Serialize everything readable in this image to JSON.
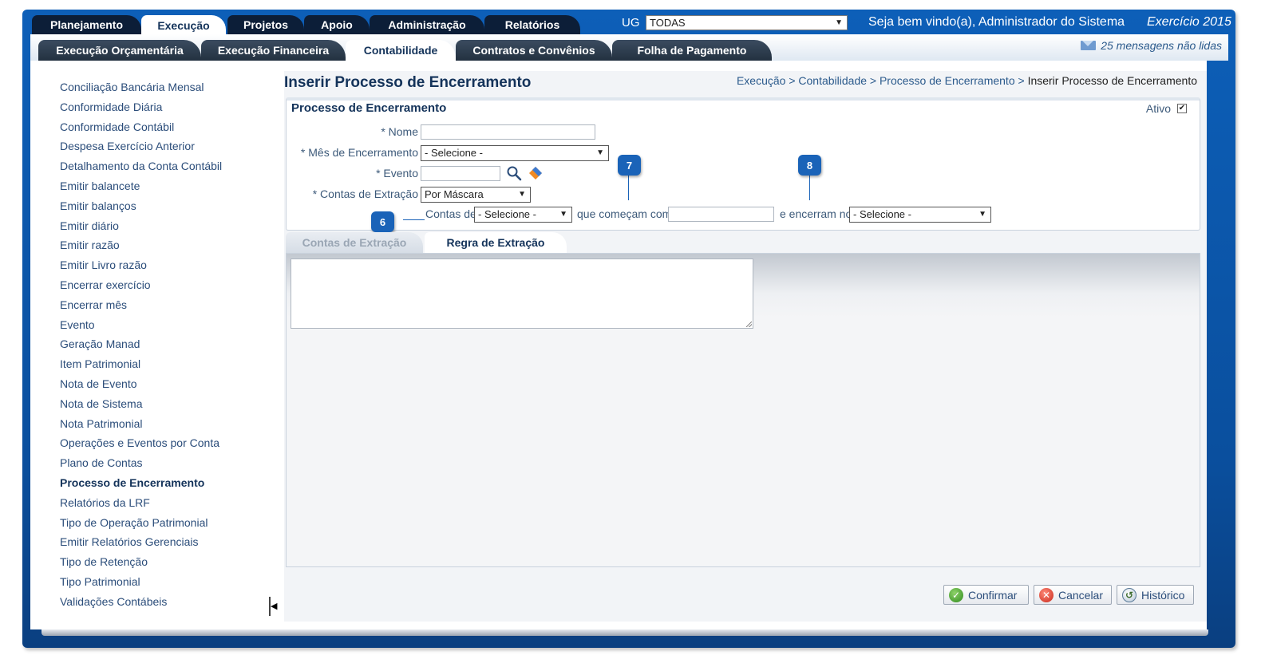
{
  "top_tabs": [
    {
      "label": "Planejamento"
    },
    {
      "label": "Execução"
    },
    {
      "label": "Projetos"
    },
    {
      "label": "Apoio"
    },
    {
      "label": "Administração"
    },
    {
      "label": "Relatórios"
    }
  ],
  "header": {
    "ug_label": "UG",
    "ug_value": "TODAS",
    "welcome": "Seja bem vindo(a), Administrador do Sistema",
    "exercicio": "Exercício 2015"
  },
  "sub_tabs": [
    {
      "label": "Execução Orçamentária"
    },
    {
      "label": "Execução Financeira"
    },
    {
      "label": "Contabilidade"
    },
    {
      "label": "Contratos e Convênios"
    },
    {
      "label": "Folha de Pagamento"
    }
  ],
  "messages": "25 mensagens não lidas",
  "sidebar": {
    "items": [
      {
        "label": "Conciliação Bancária Mensal"
      },
      {
        "label": "Conformidade Diária"
      },
      {
        "label": "Conformidade Contábil"
      },
      {
        "label": "Despesa Exercício Anterior"
      },
      {
        "label": "Detalhamento da Conta Contábil"
      },
      {
        "label": "Emitir balancete"
      },
      {
        "label": "Emitir balanços"
      },
      {
        "label": "Emitir diário"
      },
      {
        "label": "Emitir razão"
      },
      {
        "label": "Emitir Livro razão"
      },
      {
        "label": "Encerrar exercício"
      },
      {
        "label": "Encerrar mês"
      },
      {
        "label": "Evento"
      },
      {
        "label": "Geração Manad"
      },
      {
        "label": "Item Patrimonial"
      },
      {
        "label": "Nota de Evento"
      },
      {
        "label": "Nota de Sistema"
      },
      {
        "label": "Nota Patrimonial"
      },
      {
        "label": "Operações e Eventos por Conta"
      },
      {
        "label": "Plano de Contas"
      },
      {
        "label": "Processo de Encerramento"
      },
      {
        "label": "Relatórios da LRF"
      },
      {
        "label": "Tipo de Operação Patrimonial"
      },
      {
        "label": "Emitir Relatórios Gerenciais"
      },
      {
        "label": "Tipo de Retenção"
      },
      {
        "label": "Tipo Patrimonial"
      },
      {
        "label": "Validações Contábeis"
      }
    ]
  },
  "page": {
    "title": "Inserir Processo de Encerramento",
    "breadcrumb": {
      "trail": "Execução > Contabilidade > Processo de Encerramento > ",
      "current": "Inserir Processo de Encerramento"
    }
  },
  "form": {
    "panel_title": "Processo de Encerramento",
    "ativo_label": "Ativo",
    "nome_label": "* Nome",
    "nome_value": "",
    "mes_label": "* Mês de Encerramento",
    "mes_value": "- Selecione -",
    "evento_label": "* Evento",
    "evento_value": "",
    "contas_extracao_label": "* Contas de Extração",
    "contas_extracao_value": "Por Máscara",
    "contas_de_label": "Contas de",
    "contas_de_value": "- Selecione -",
    "comecam_label": "que começam com",
    "comecam_value": "",
    "encerram_label": "e encerram no",
    "encerram_value": "- Selecione -"
  },
  "callouts": [
    "6",
    "7",
    "8"
  ],
  "inner_tabs": [
    {
      "label": "Contas de Extração"
    },
    {
      "label": "Regra de Extração"
    }
  ],
  "buttons": {
    "confirmar": "Confirmar",
    "cancelar": "Cancelar",
    "historico": "Histórico"
  },
  "icons": [
    "search-icon",
    "tag-icon",
    "mail-icon",
    "confirm-check-icon",
    "cancel-x-icon",
    "history-icon"
  ]
}
